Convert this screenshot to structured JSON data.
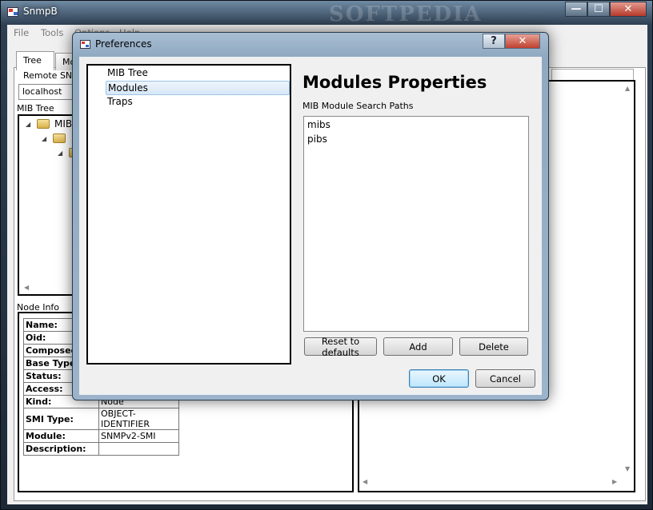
{
  "main_window": {
    "title": "SnmpB",
    "watermark": "SOFTPEDIA",
    "menu": [
      "File",
      "Tools",
      "Options",
      "Help"
    ],
    "tabs": [
      {
        "label": "Tree"
      },
      {
        "label": "Mo"
      }
    ],
    "remote_agent_label": "Remote SNM",
    "remote_agent_value": "localhost",
    "mib_tree_label": "MIB Tree",
    "mib_tree_items": [
      {
        "label": "MIB"
      },
      {
        "label": ""
      },
      {
        "label": ""
      }
    ],
    "node_info_label": "Node Info",
    "node_info": [
      {
        "key": "Name:",
        "value": ""
      },
      {
        "key": "Oid:",
        "value": ""
      },
      {
        "key": "Composed",
        "value": ""
      },
      {
        "key": "Base Type:",
        "value": ""
      },
      {
        "key": "Status:",
        "value": ""
      },
      {
        "key": "Access:",
        "value": ""
      },
      {
        "key": "Kind:",
        "value": "Node"
      },
      {
        "key": "SMI Type:",
        "value": "OBJECT-IDENTIFIER"
      },
      {
        "key": "Module:",
        "value": "SNMPv2-SMI"
      },
      {
        "key": "Description:",
        "value": ""
      }
    ]
  },
  "dialog": {
    "title": "Preferences",
    "help_glyph": "?",
    "close_glyph": "✕",
    "nav_items": [
      {
        "label": "MIB Tree",
        "selected": false
      },
      {
        "label": "Modules",
        "selected": true
      },
      {
        "label": "Traps",
        "selected": false
      }
    ],
    "page_title": "Modules Properties",
    "paths_label": "MIB Module Search Paths",
    "paths": [
      "mibs",
      "pibs"
    ],
    "buttons": {
      "reset": "Reset to defaults",
      "add": "Add",
      "delete": "Delete",
      "ok": "OK",
      "cancel": "Cancel"
    }
  },
  "main_caption": {
    "minimize": "—",
    "maximize": "☐",
    "close": "✕"
  },
  "icons": [
    "app-icon",
    "folder-icon",
    "expand-arrow-icon",
    "help-icon",
    "close-icon",
    "minimize-icon",
    "maximize-icon"
  ]
}
